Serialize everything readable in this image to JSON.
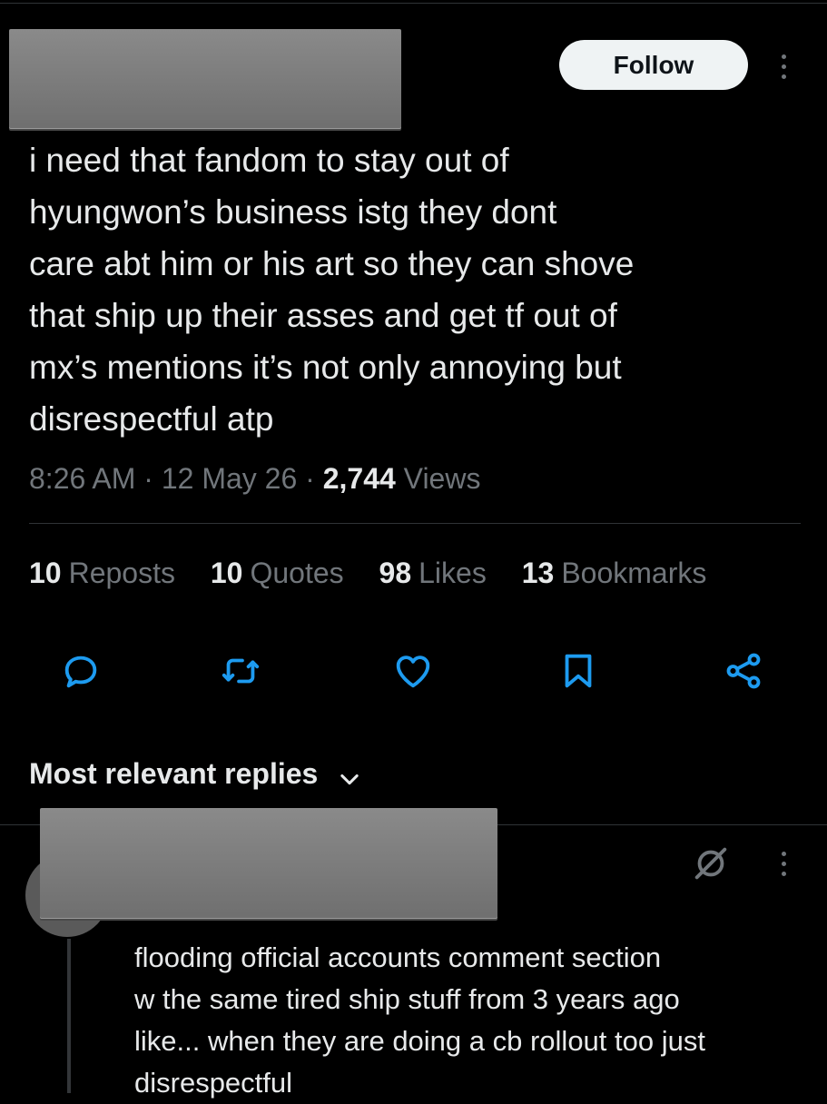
{
  "post": {
    "follow_label": "Follow",
    "text": "i need that fandom to stay out of\nhyungwon’s business istg they dont\ncare abt him or his art so they can shove\nthat ship up their asses and get tf out of\nmx’s mentions it’s not only annoying but\ndisrespectful atp",
    "time": "8:26 AM",
    "sep": "·",
    "date": "12 May 26",
    "views_count": "2,744",
    "views_label": "Views"
  },
  "stats": [
    {
      "count": "10",
      "label": "Reposts"
    },
    {
      "count": "10",
      "label": "Quotes"
    },
    {
      "count": "98",
      "label": "Likes"
    },
    {
      "count": "13",
      "label": "Bookmarks"
    }
  ],
  "actions": {
    "icons": [
      "reply-icon",
      "repost-icon",
      "like-icon",
      "bookmark-icon",
      "share-icon"
    ]
  },
  "replies": {
    "header": "Most relevant replies",
    "items": [
      {
        "text": "flooding official accounts comment section\nw the same tired ship stuff from 3 years ago\nlike... when they are doing a cb rollout too just\ndisrespectful"
      }
    ]
  },
  "colors": {
    "background": "#000000",
    "text": "#e7e9ea",
    "secondary": "#71767b",
    "divider": "#2f3336",
    "follow_bg": "#eff3f4"
  }
}
